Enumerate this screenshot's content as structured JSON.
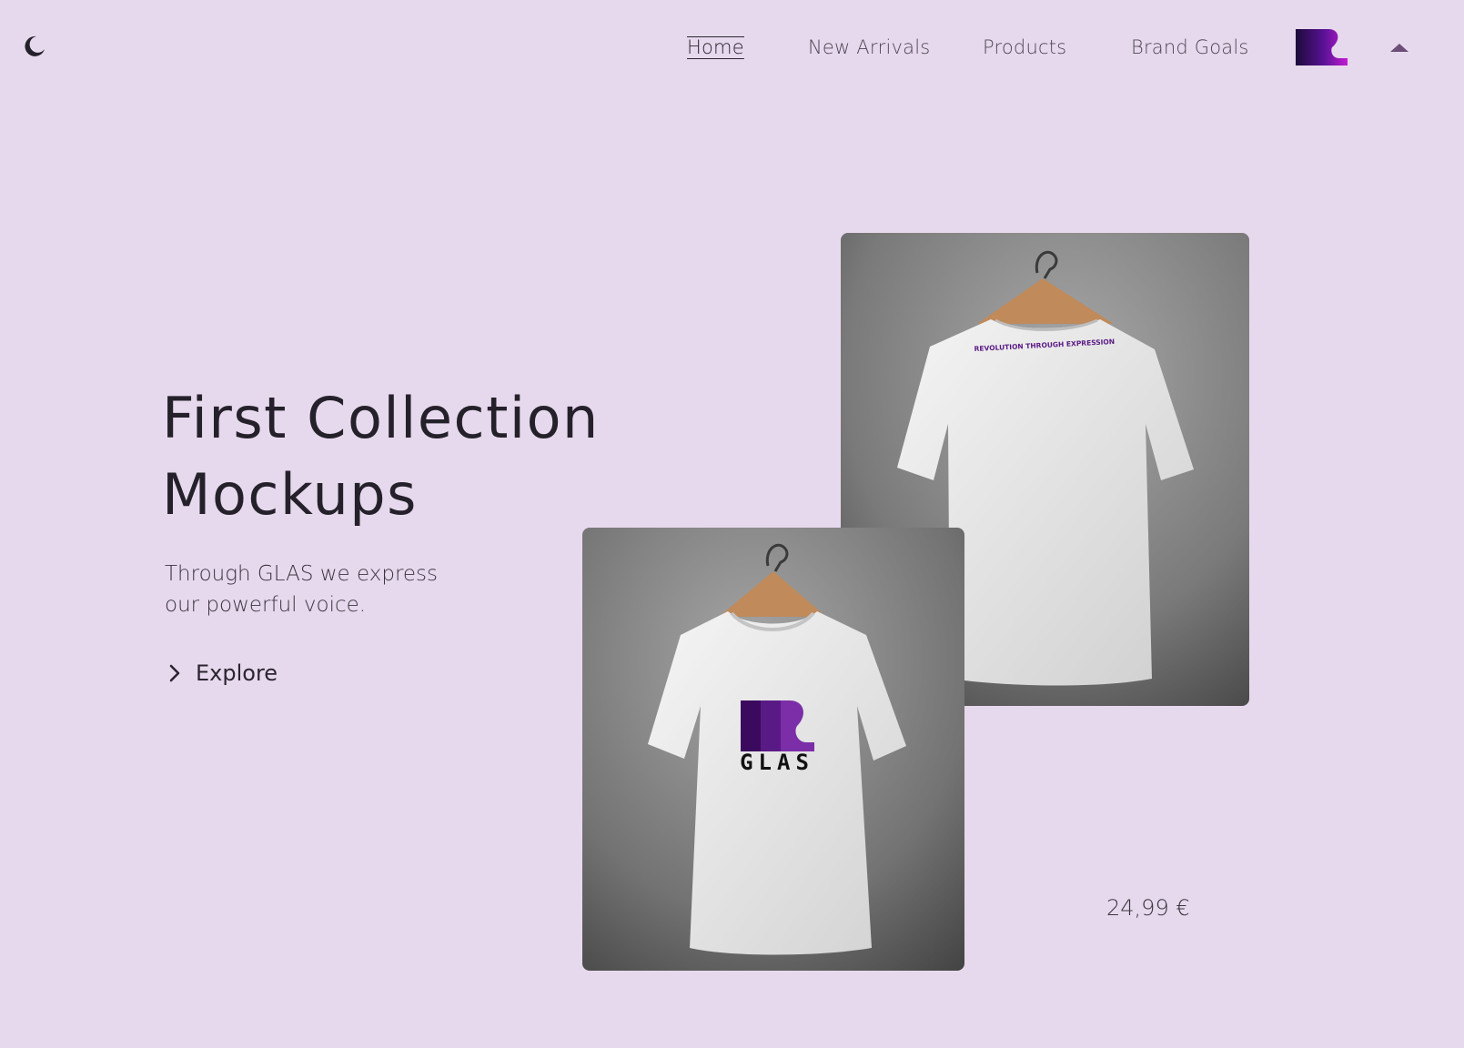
{
  "header": {
    "theme_icon": "moon-icon",
    "nav": [
      {
        "label": "Home",
        "active": true
      },
      {
        "label": "New Arrivals",
        "active": false
      },
      {
        "label": "Products",
        "active": false
      },
      {
        "label": "Brand Goals",
        "active": false
      }
    ],
    "brand_icon": "glas-logo-mark",
    "toggle_icon": "caret-up-icon"
  },
  "hero": {
    "title_line1": "First Collection",
    "title_line2": "Mockups",
    "subtitle_line1": "Through GLAS we express",
    "subtitle_line2": "our powerful voice.",
    "cta_label": "Explore",
    "cta_icon": "chevron-right-icon"
  },
  "products": {
    "back_print_text": "REVOLUTION THROUGH EXPRESSION",
    "front_logo_text": "GLAS",
    "price": "24,99 €"
  },
  "colors": {
    "background": "#e7d9ed",
    "text": "#2a2530",
    "accent_purple": "#6a2a96",
    "accent_magenta": "#a019c2",
    "caret": "#6b4f78"
  }
}
